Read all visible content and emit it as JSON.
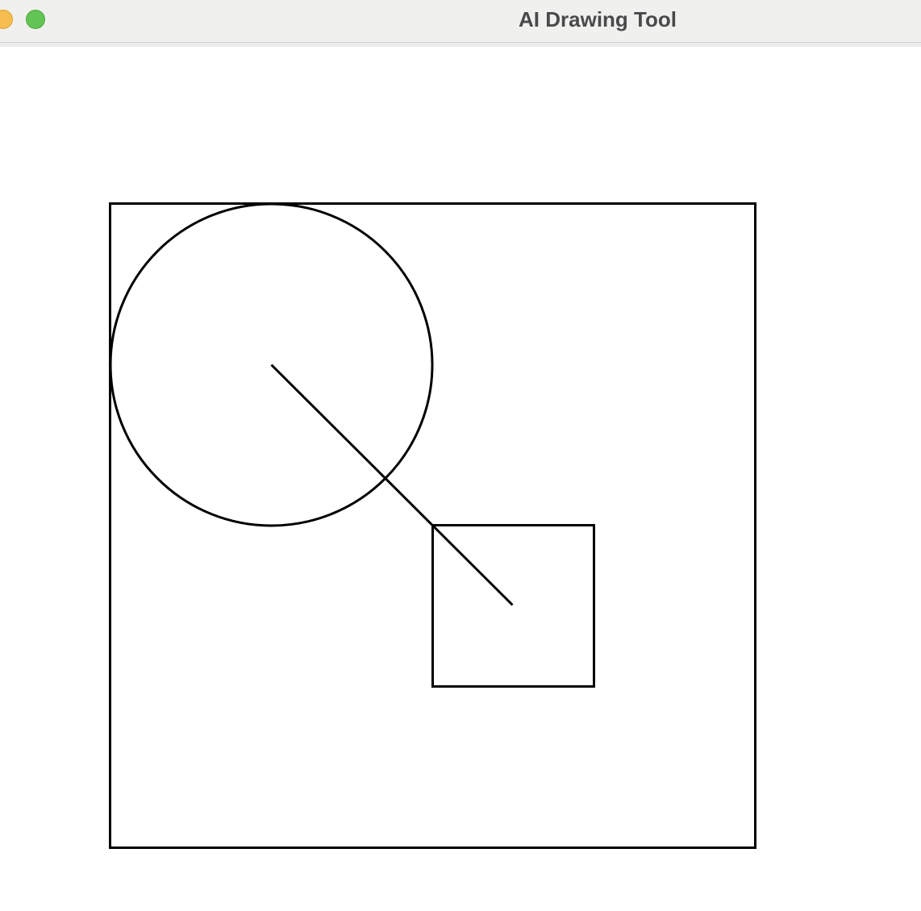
{
  "window": {
    "title": "AI Drawing Tool",
    "traffic_lights": [
      {
        "name": "minimize",
        "color": "#f6be4f"
      },
      {
        "name": "zoom",
        "color": "#61c454"
      }
    ]
  },
  "canvas": {
    "background": "#ffffff",
    "stroke_color": "#000000",
    "shapes": [
      {
        "type": "rectangle",
        "name": "outer-square"
      },
      {
        "type": "circle",
        "name": "circle"
      },
      {
        "type": "rectangle",
        "name": "inner-square"
      },
      {
        "type": "line",
        "name": "diagonal-line"
      }
    ]
  }
}
